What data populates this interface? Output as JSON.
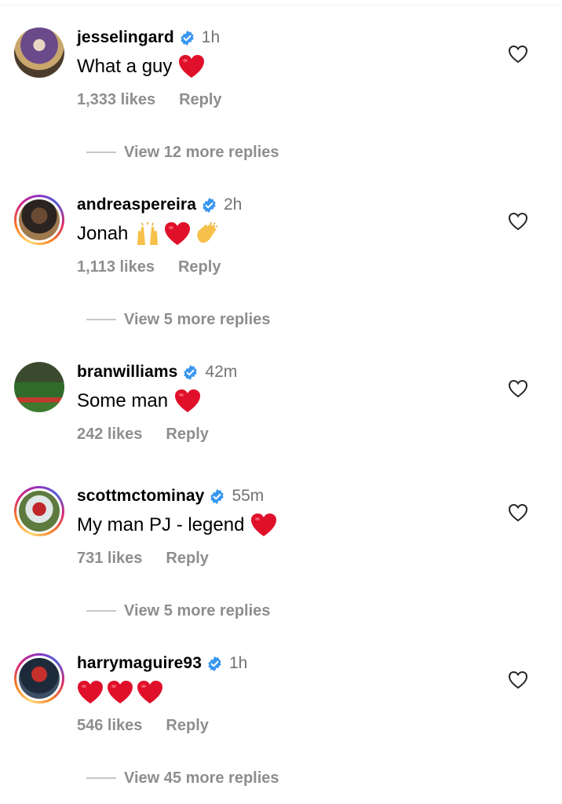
{
  "comments": [
    {
      "username": "jesselingard",
      "time": "1h",
      "text": "What a guy",
      "likes": "1,333 likes",
      "reply": "Reply",
      "view_more": "View 12 more replies",
      "emojis": [
        "red-heart"
      ]
    },
    {
      "username": "andreaspereira",
      "time": "2h",
      "text": "Jonah",
      "likes": "1,113 likes",
      "reply": "Reply",
      "view_more": "View 5 more replies",
      "emojis": [
        "raising-hands",
        "red-heart",
        "clapping-hands"
      ]
    },
    {
      "username": "branwilliams",
      "time": "42m",
      "text": "Some man",
      "likes": "242 likes",
      "reply": "Reply",
      "emojis": [
        "red-heart"
      ]
    },
    {
      "username": "scottmctominay",
      "time": "55m",
      "text": "My man PJ - legend",
      "likes": "731 likes",
      "reply": "Reply",
      "view_more": "View 5 more replies",
      "emojis": [
        "red-heart"
      ]
    },
    {
      "username": "harrymaguire93",
      "time": "1h",
      "text": "",
      "likes": "546 likes",
      "reply": "Reply",
      "view_more": "View 45 more replies",
      "emojis": [
        "red-heart",
        "red-heart",
        "red-heart"
      ]
    }
  ],
  "colors": {
    "verified_blue": "#3897f0",
    "secondary_text": "#8e8e8e",
    "heart_red": "#e0102a"
  },
  "icons": {
    "like": "heart-outline-icon",
    "verified": "verified-badge-icon"
  }
}
